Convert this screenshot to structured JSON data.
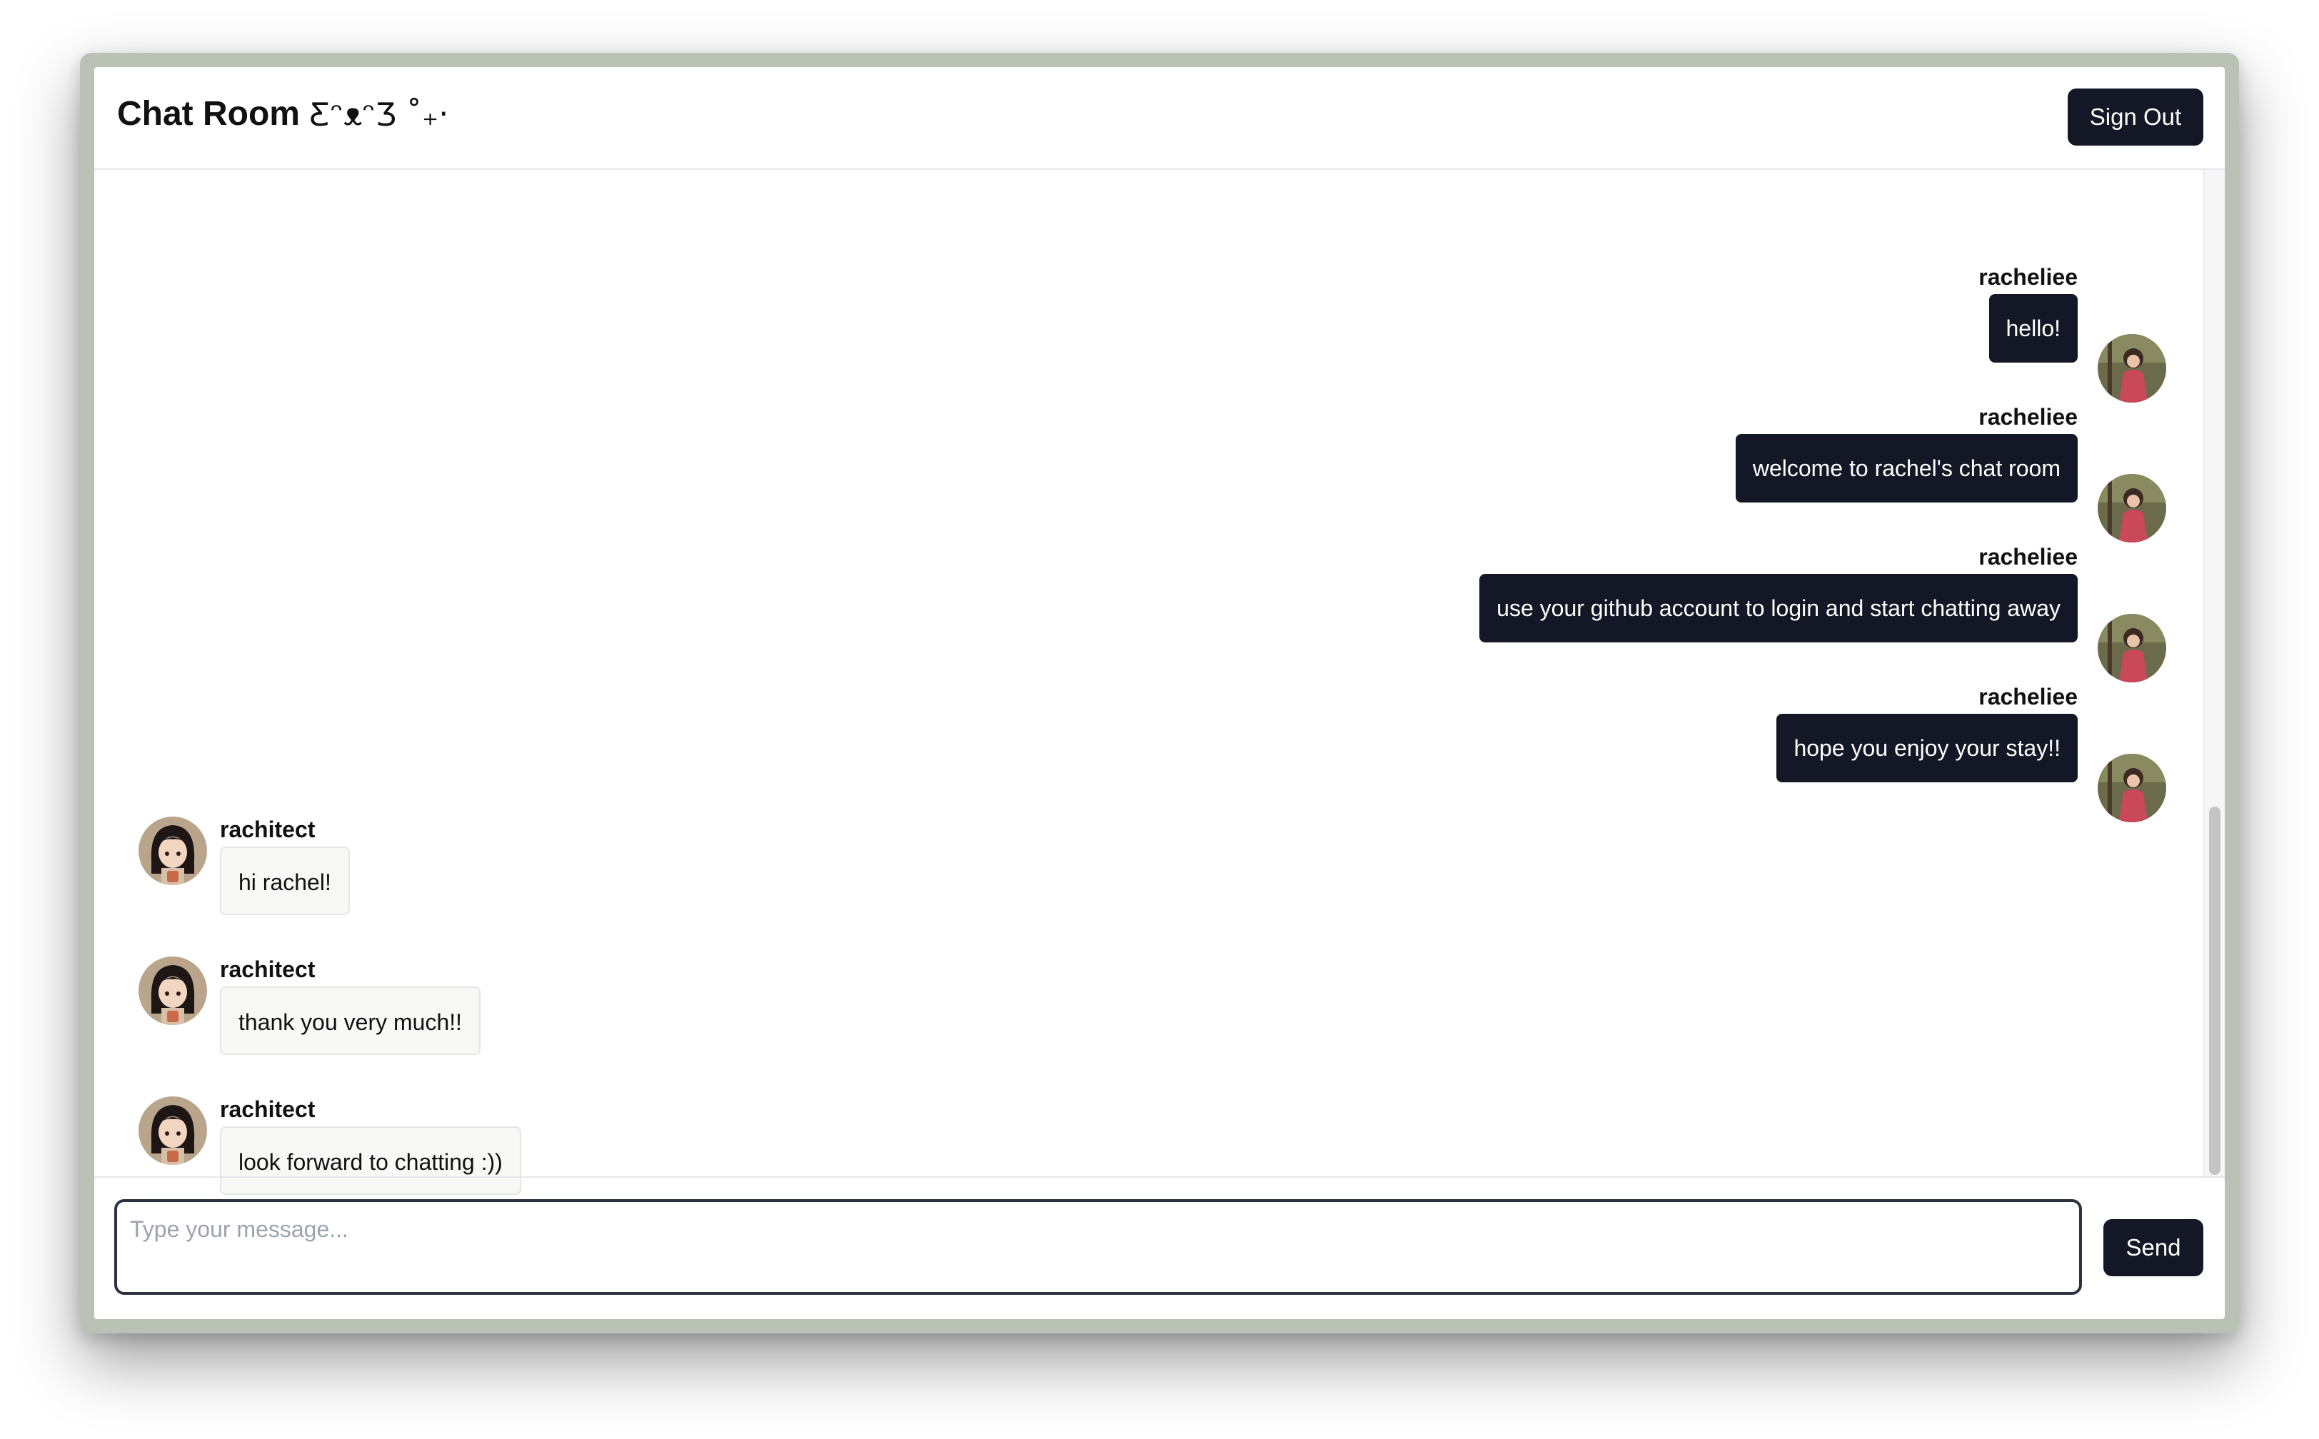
{
  "header": {
    "title": "Chat Room",
    "title_decoration": "ƸᵔᴥᵔƷ ˚₊‧",
    "sign_out_label": "Sign Out"
  },
  "messages": [
    {
      "side": "right",
      "user": "racheliee",
      "text": "hello!"
    },
    {
      "side": "right",
      "user": "racheliee",
      "text": "welcome to rachel's chat room"
    },
    {
      "side": "right",
      "user": "racheliee",
      "text": "use your github account to login and start chatting away"
    },
    {
      "side": "right",
      "user": "racheliee",
      "text": "hope you enjoy your stay!!"
    },
    {
      "side": "left",
      "user": "rachitect",
      "text": "hi rachel!"
    },
    {
      "side": "left",
      "user": "rachitect",
      "text": "thank you very much!!"
    },
    {
      "side": "left",
      "user": "rachitect",
      "text": "look forward to chatting :))"
    }
  ],
  "composer": {
    "placeholder": "Type your message...",
    "value": "",
    "send_label": "Send"
  },
  "colors": {
    "primary_dark": "#141826",
    "frame": "#b9c2b4",
    "bubble_light": "#f8f8f6"
  }
}
